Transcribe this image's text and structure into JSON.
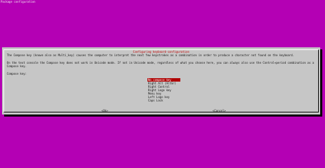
{
  "screen": {
    "title": "Package configuration"
  },
  "dialog": {
    "title": "Configuring keyboard-configuration",
    "paragraph_1": "The Compose key (known also as Multi_key) causes the computer to interpret the next few keystrokes as a combination in order to produce a character not found on the keyboard.",
    "paragraph_2": "On the text console the Compose key does not work in Unicode mode. If not in Unicode mode, regardless of what you choose here, you can always also use the Control+period combination as a Compose key.",
    "prompt": "Compose key:",
    "options": [
      {
        "label": "No compose key",
        "selected": true
      },
      {
        "label": "Right Alt (AltGr)",
        "selected": false
      },
      {
        "label": "Right Control",
        "selected": false
      },
      {
        "label": "Right Logo key",
        "selected": false
      },
      {
        "label": "Menu key",
        "selected": false
      },
      {
        "label": "Left Logo key",
        "selected": false
      },
      {
        "label": "Caps Lock",
        "selected": false
      }
    ],
    "ok_label": "<Ok>",
    "cancel_label": "<Cancel>"
  },
  "colors": {
    "background": "#b400b4",
    "dialog": "#c6c6c6",
    "title_text": "#c40000",
    "selection": "#b00000"
  }
}
